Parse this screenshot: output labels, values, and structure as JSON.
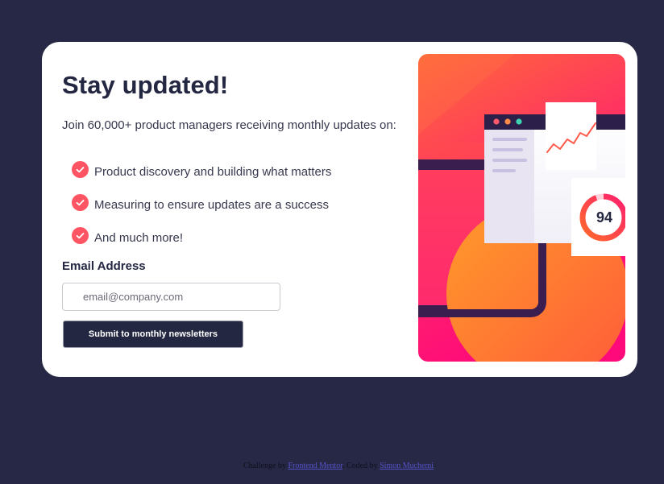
{
  "signup": {
    "title": "Stay updated!",
    "intro": "Join 60,000+ product managers receiving monthly updates on:",
    "features": [
      "Product discovery and building what matters",
      "Measuring to ensure updates are a success",
      "And much more!"
    ],
    "email_label": "Email Address",
    "email_placeholder": "email@company.com",
    "email_value": "",
    "submit_label": "Submit to monthly newsletters"
  },
  "illustration": {
    "score_value": "94",
    "icon": "dashboard-illustration"
  },
  "attribution": {
    "challenge_prefix": "Challenge by",
    "challenge_link": "Frontend Mentor",
    "coded_prefix": ". Coded by",
    "author_link": "Simon Muchemi"
  },
  "colors": {
    "background": "#272845",
    "card": "#ffffff",
    "dark_navy": "#242742",
    "accent_red": "#ff5463",
    "accent_orange": "#ff6a3a",
    "accent_pink": "#ff1a73"
  }
}
